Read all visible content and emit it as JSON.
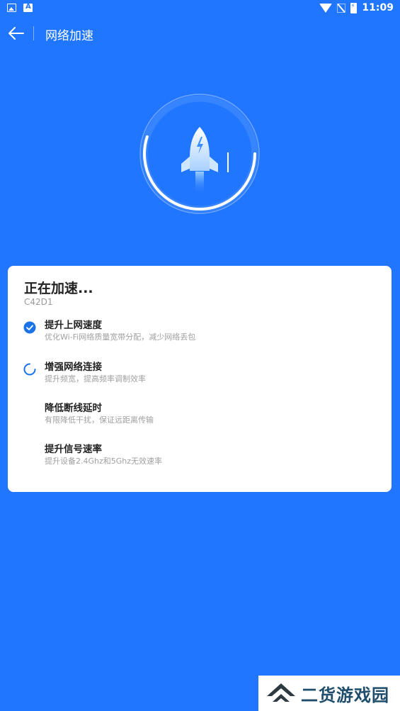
{
  "status_bar": {
    "time": "11:09"
  },
  "toolbar": {
    "title": "网络加速"
  },
  "progress": 0.55,
  "card": {
    "title": "正在加速...",
    "subtitle": "C42D1",
    "steps": [
      {
        "title": "提升上网速度",
        "desc": "优化Wi-Fi网络质量宽带分配，减少网络丢包",
        "state": "done"
      },
      {
        "title": "增强网络连接",
        "desc": "提升频宽，提高频率调制效率",
        "state": "loading"
      },
      {
        "title": "降低断线延时",
        "desc": "有限降低干扰，保证远距离传输",
        "state": "pending"
      },
      {
        "title": "提升信号速率",
        "desc": "提升设备2.4Ghz和5Ghz无效速率",
        "state": "pending"
      }
    ]
  },
  "watermark": {
    "text": "二货游戏园"
  },
  "colors": {
    "background": "#2176ff",
    "accent": "#1a73e8",
    "card": "#ffffff"
  }
}
